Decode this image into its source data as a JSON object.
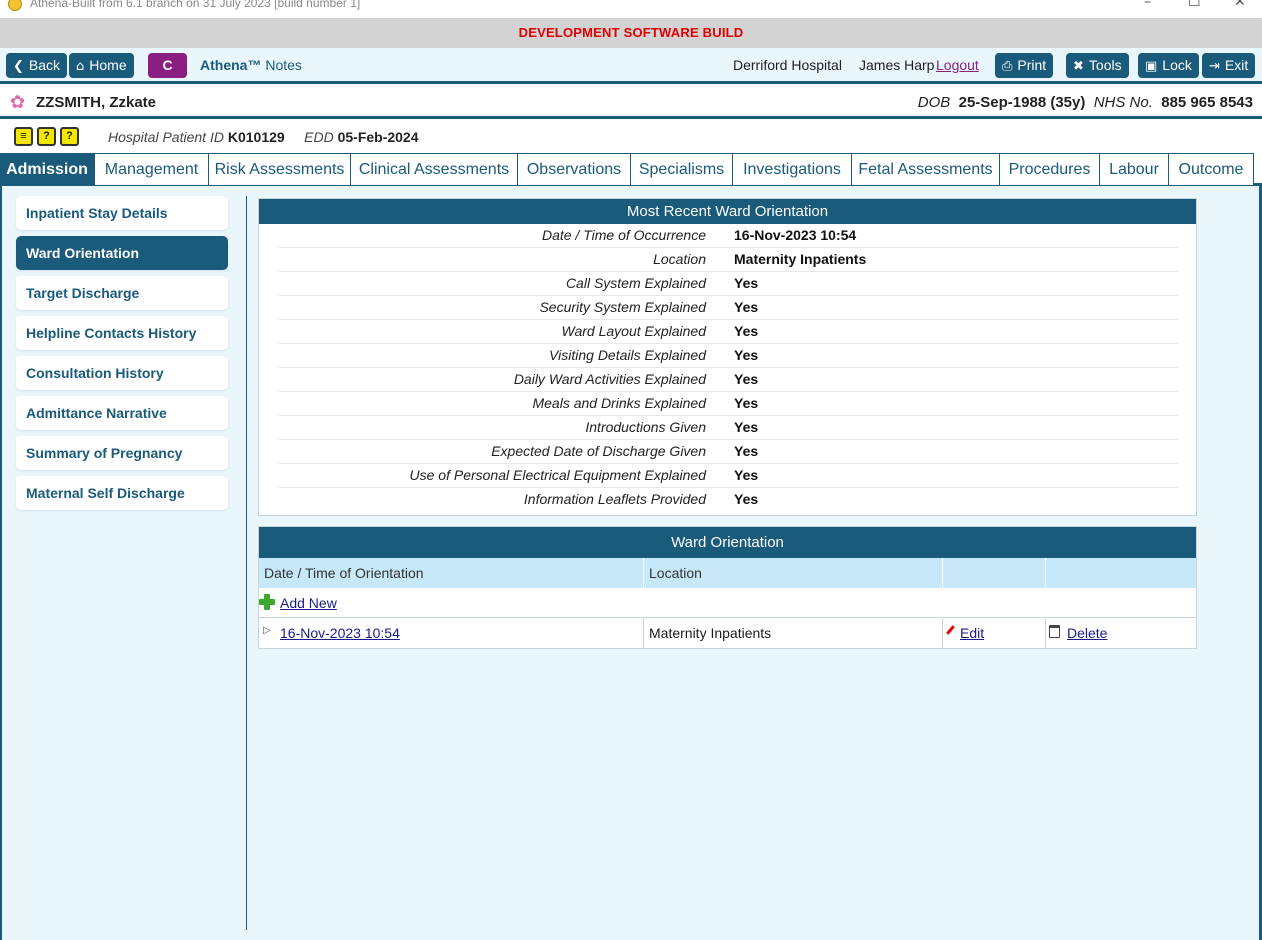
{
  "window": {
    "title": "Athena-Built from 6.1 branch on 31 July 2023 [build number 1]",
    "controls": [
      "–",
      "☐",
      "✕"
    ]
  },
  "dev_banner": "DEVELOPMENT SOFTWARE BUILD",
  "toolbar": {
    "back_label": "Back",
    "home_label": "Home",
    "c_label": "C",
    "app_name_bold": "Athena™",
    "app_name_rest": "Notes",
    "hospital": "Derriford Hospital",
    "user": "James Harp",
    "logout_label": "Logout",
    "print_label": "Print",
    "tools_label": "Tools",
    "lock_label": "Lock",
    "exit_label": "Exit"
  },
  "patient": {
    "name": "ZZSMITH, Zzkate",
    "dob_label": "DOB",
    "dob_value": "25-Sep-1988 (35y)",
    "nhs_label": "NHS No.",
    "nhs_value": "885 965 8543",
    "hospital_id_label": "Hospital Patient ID",
    "hospital_id_value": "K010129",
    "edd_label": "EDD",
    "edd_value": "05-Feb-2024",
    "alert_icons": [
      "notes-alert-icon",
      "question-alert-icon",
      "question-alert-icon"
    ]
  },
  "tabs": [
    "Admission",
    "Management",
    "Risk Assessments",
    "Clinical Assessments",
    "Observations",
    "Specialisms",
    "Investigations",
    "Fetal Assessments",
    "Procedures",
    "Labour",
    "Outcome"
  ],
  "active_tab": "Admission",
  "sidebar": {
    "items": [
      "Inpatient Stay Details",
      "Ward Orientation",
      "Target Discharge",
      "Helpline Contacts History",
      "Consultation History",
      "Admittance Narrative",
      "Summary of Pregnancy",
      "Maternal Self Discharge"
    ],
    "active": "Ward Orientation"
  },
  "recent": {
    "title": "Most Recent Ward Orientation",
    "rows": [
      {
        "label": "Date / Time of Occurrence",
        "value": "16-Nov-2023 10:54"
      },
      {
        "label": "Location",
        "value": "Maternity Inpatients"
      },
      {
        "label": "Call System Explained",
        "value": "Yes"
      },
      {
        "label": "Security System Explained",
        "value": "Yes"
      },
      {
        "label": "Ward Layout Explained",
        "value": "Yes"
      },
      {
        "label": "Visiting Details Explained",
        "value": "Yes"
      },
      {
        "label": "Daily Ward Activities Explained",
        "value": "Yes"
      },
      {
        "label": "Meals and Drinks Explained",
        "value": "Yes"
      },
      {
        "label": "Introductions Given",
        "value": "Yes"
      },
      {
        "label": "Expected Date of Discharge Given",
        "value": "Yes"
      },
      {
        "label": "Use of Personal Electrical Equipment Explained",
        "value": "Yes"
      },
      {
        "label": "Information Leaflets Provided",
        "value": "Yes"
      }
    ]
  },
  "ward_table": {
    "title": "Ward Orientation",
    "columns": [
      "Date / Time of Orientation",
      "Location",
      "",
      ""
    ],
    "add_label": "Add New",
    "rows": [
      {
        "date": "16-Nov-2023 10:54",
        "location": "Maternity Inpatients",
        "edit": "Edit",
        "delete": "Delete"
      }
    ]
  }
}
